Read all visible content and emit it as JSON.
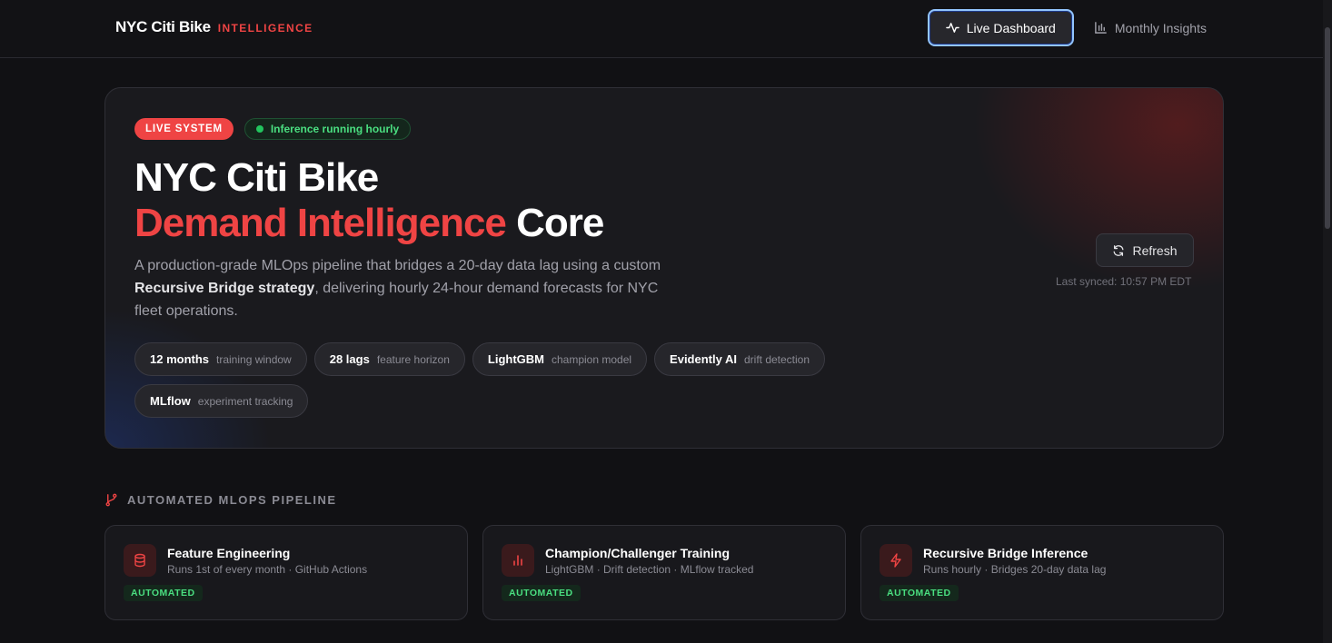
{
  "header": {
    "brand_name": "NYC Citi Bike",
    "brand_tag": "INTELLIGENCE",
    "nav": [
      {
        "label": "Live Dashboard",
        "icon": "activity-icon",
        "active": true
      },
      {
        "label": "Monthly Insights",
        "icon": "bar-chart-icon",
        "active": false
      }
    ]
  },
  "hero": {
    "badge_live": "LIVE SYSTEM",
    "badge_status": "Inference running hourly",
    "title_line1": "NYC Citi Bike",
    "title_accent": "Demand Intelligence",
    "title_end": "Core",
    "desc_part1": "A production-grade MLOps pipeline that bridges a 20-day data lag using a custom ",
    "desc_bold": "Recursive Bridge strategy",
    "desc_part2": ", delivering hourly 24-hour demand forecasts for NYC fleet operations.",
    "chips": [
      {
        "strong": "12 months",
        "sub": "training window"
      },
      {
        "strong": "28 lags",
        "sub": "feature horizon"
      },
      {
        "strong": "LightGBM",
        "sub": "champion model"
      },
      {
        "strong": "Evidently AI",
        "sub": "drift detection"
      },
      {
        "strong": "MLflow",
        "sub": "experiment tracking"
      }
    ],
    "refresh_label": "Refresh",
    "last_synced": "Last synced: 10:57 PM EDT"
  },
  "pipeline": {
    "heading": "AUTOMATED MLOPS PIPELINE",
    "cards": [
      {
        "title": "Feature Engineering",
        "sub": "Runs 1st of every month · GitHub Actions",
        "tag": "AUTOMATED",
        "icon": "database-icon"
      },
      {
        "title": "Champion/Challenger Training",
        "sub": "LightGBM · Drift detection · MLflow tracked",
        "tag": "AUTOMATED",
        "icon": "bar-chart-icon"
      },
      {
        "title": "Recursive Bridge Inference",
        "sub": "Runs hourly · Bridges 20-day data lag",
        "tag": "AUTOMATED",
        "icon": "lightning-icon"
      }
    ]
  },
  "colors": {
    "accent": "#ef4444",
    "success": "#4ade80",
    "background": "#111114"
  }
}
